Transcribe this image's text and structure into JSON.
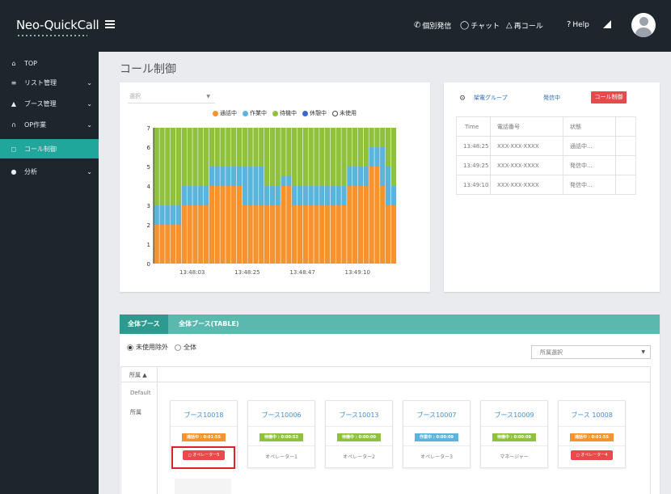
{
  "app": {
    "logo": "Neo-QuickCall"
  },
  "topnav": {
    "items": [
      {
        "icon": "phone-icon",
        "icon_glyph": "✆",
        "label": "個別発信"
      },
      {
        "icon": "chat-icon",
        "icon_glyph": "◯",
        "label": "チャット"
      },
      {
        "icon": "bell-icon",
        "icon_glyph": "△",
        "label": "再コール"
      },
      {
        "icon": "help-icon",
        "icon_glyph": "?",
        "label": "Help"
      }
    ]
  },
  "sidebar": {
    "items": [
      {
        "label": "TOP",
        "icon": "home-icon",
        "glyph": "⌂",
        "chevron": false,
        "active": false
      },
      {
        "label": "リスト管理",
        "icon": "list-icon",
        "glyph": "≡",
        "chevron": true,
        "active": false
      },
      {
        "label": "ブース管理",
        "icon": "user-icon",
        "glyph": "▲",
        "chevron": true,
        "active": false
      },
      {
        "label": "OP作業",
        "icon": "headset-icon",
        "glyph": "∩",
        "chevron": true,
        "active": false
      },
      {
        "label": "コール制御",
        "icon": "chat-icon",
        "glyph": "◻",
        "chevron": false,
        "active": true
      },
      {
        "label": "分析",
        "icon": "pie-icon",
        "glyph": "●",
        "chevron": true,
        "active": false
      }
    ]
  },
  "page": {
    "title": "コール制御"
  },
  "chart_panel": {
    "select_placeholder": "選択",
    "legend": [
      {
        "label": "通話中",
        "color": "#f7932e"
      },
      {
        "label": "作業中",
        "color": "#5ab4dc"
      },
      {
        "label": "待機中",
        "color": "#8fc13c"
      },
      {
        "label": "休憩中",
        "color": "#3c69c9"
      },
      {
        "label": "未使用",
        "color": "#ffffff"
      }
    ]
  },
  "chart_data": {
    "type": "bar",
    "stacked": true,
    "ylim": [
      0,
      7
    ],
    "yticks": [
      "0",
      "1",
      "2",
      "3",
      "4",
      "5",
      "6",
      "7"
    ],
    "xtick_labels": [
      "13:48:03",
      "13:48:25",
      "13:48:47",
      "13:49:10"
    ],
    "xtick_positions": [
      7,
      17,
      27,
      37
    ],
    "series": [
      {
        "name": "通話中",
        "color": "#f7932e",
        "values": [
          2,
          2,
          2,
          2,
          2,
          3,
          3,
          3,
          3,
          3,
          4,
          4,
          4,
          4,
          4,
          4,
          3,
          3,
          3,
          3,
          3,
          3,
          3,
          4,
          4,
          3,
          3,
          3,
          3,
          3,
          3,
          3,
          3,
          3,
          3,
          4,
          4,
          4,
          4,
          5,
          5,
          4,
          3,
          3
        ]
      },
      {
        "name": "作業中",
        "color": "#5ab4dc",
        "values": [
          1,
          1,
          1,
          1,
          1,
          1,
          1,
          1,
          1,
          1,
          1,
          1,
          1,
          1,
          1,
          1,
          2,
          2,
          2,
          2,
          1,
          1,
          1,
          0.5,
          0.5,
          1,
          1,
          1,
          1,
          1,
          1,
          1,
          1,
          1,
          1,
          1,
          1,
          1,
          1,
          1,
          1,
          2,
          2,
          1
        ]
      },
      {
        "name": "待機中",
        "color": "#8fc13c",
        "values": [
          4,
          4,
          4,
          4,
          4,
          3,
          3,
          3,
          3,
          3,
          2,
          2,
          2,
          2,
          2,
          2,
          2,
          2,
          2,
          2,
          3,
          3,
          3,
          2.5,
          2.5,
          3,
          3,
          3,
          3,
          3,
          3,
          3,
          3,
          3,
          3,
          2,
          2,
          2,
          2,
          1,
          1,
          1,
          2,
          3
        ]
      },
      {
        "name": "休憩中",
        "color": "#3c69c9",
        "values": [
          0,
          0,
          0,
          0,
          0,
          0,
          0,
          0,
          0,
          0,
          0,
          0,
          0,
          0,
          0,
          0,
          0,
          0,
          0,
          0,
          0,
          0,
          0,
          0,
          0,
          0,
          0,
          0,
          0,
          0,
          0,
          0,
          0,
          0,
          0,
          0,
          0,
          0,
          0,
          0,
          0,
          0,
          0,
          0
        ]
      },
      {
        "name": "未使用",
        "color": "#ffffff",
        "values": [
          0,
          0,
          0,
          0,
          0,
          0,
          0,
          0,
          0,
          0,
          0,
          0,
          0,
          0,
          0,
          0,
          0,
          0,
          0,
          0,
          0,
          0,
          0,
          0,
          0,
          0,
          0,
          0,
          0,
          0,
          0,
          0,
          0,
          0,
          0,
          0,
          0,
          0,
          0,
          0,
          0,
          0,
          0,
          0
        ]
      }
    ]
  },
  "right_panel": {
    "group_link": "架電グループ",
    "status_link": "発信中",
    "call_button": "コール制御",
    "table": {
      "headers": [
        "Time",
        "電話番号",
        "状態"
      ],
      "rows": [
        [
          "13:48:25",
          "XXX-XXX-XXXX",
          "通話中..."
        ],
        [
          "13:49:25",
          "XXX-XXX-XXXX",
          "発信中..."
        ],
        [
          "13:49:10",
          "XXX-XXX-XXXX",
          "発信中..."
        ]
      ]
    }
  },
  "booth_panel": {
    "tabs": [
      "全体ブース",
      "全体ブース(TABLE)"
    ],
    "radios": [
      "未使用除外",
      "全体"
    ],
    "affiliation_select": "所属選択",
    "sort_label": "所属 ▲",
    "default_label": "Default",
    "affiliation_label": "所属",
    "booths": [
      {
        "name": "ブース10018",
        "status": "通話中 : 0:01:55",
        "status_color": "#f7932e",
        "operator": "オペレーター5",
        "operator_button": true
      },
      {
        "name": "ブース10006",
        "status": "待機中 : 0:00:53",
        "status_color": "#8fc13c",
        "operator": "オペレーター1",
        "operator_button": false
      },
      {
        "name": "ブース10013",
        "status": "待機中 : 0:00:00",
        "status_color": "#8fc13c",
        "operator": "オペレーター2",
        "operator_button": false
      },
      {
        "name": "ブース10007",
        "status": "作業中 : 0:00:09",
        "status_color": "#5ab4dc",
        "operator": "オペレーター3",
        "operator_button": false
      },
      {
        "name": "ブース10009",
        "status": "待機中 : 0:00:09",
        "status_color": "#8fc13c",
        "operator": "マネージャー",
        "operator_button": false
      },
      {
        "name": "ブース 10008",
        "status": "通話中 : 0:01:55",
        "status_color": "#f7932e",
        "operator": "オペレーター4",
        "operator_button": true
      }
    ]
  }
}
